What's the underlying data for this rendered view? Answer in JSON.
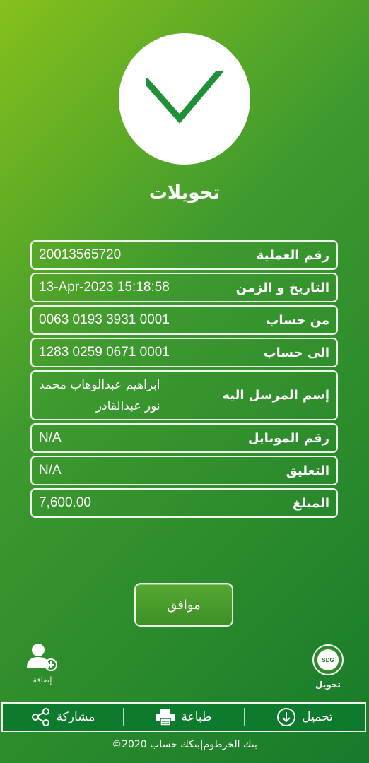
{
  "title": "تحويلات",
  "details": [
    {
      "label": "رقم العملية",
      "value": "20013565720"
    },
    {
      "label": "التاريخ و الزمن",
      "value": "13-Apr-2023 15:18:58"
    },
    {
      "label": "من حساب",
      "value": "0063 0193 3931 0001"
    },
    {
      "label": "الى حساب",
      "value": "1283 0259 0671 0001"
    },
    {
      "label": "إسم المرسل اليه",
      "value_line1": "ابراهيم عبدالوهاب محمد",
      "value_line2": "نور عبدالقادر"
    },
    {
      "label": "رقم الموبايل",
      "value": "N/A"
    },
    {
      "label": "التعليق",
      "value": "N/A"
    },
    {
      "label": "المبلغ",
      "value": "7,600.00"
    }
  ],
  "ok_button": "موافق",
  "add_label": "إضافة",
  "transfer": {
    "badge": "SDG",
    "label": "تحويل"
  },
  "bottom_bar": {
    "share": "مشاركة",
    "print": "طباعة",
    "download": "تحميل"
  },
  "footer": "©2020 بنك الخرطوم|بنكك حساب",
  "icons": {
    "success": "check-icon",
    "add": "add-user-icon",
    "share": "share-icon",
    "print": "printer-icon",
    "download": "download-icon"
  },
  "colors": {
    "check": "#1f8f3a",
    "bar": "#0e7a2d",
    "background_start": "#86c01c",
    "background_end": "#177a2a"
  }
}
